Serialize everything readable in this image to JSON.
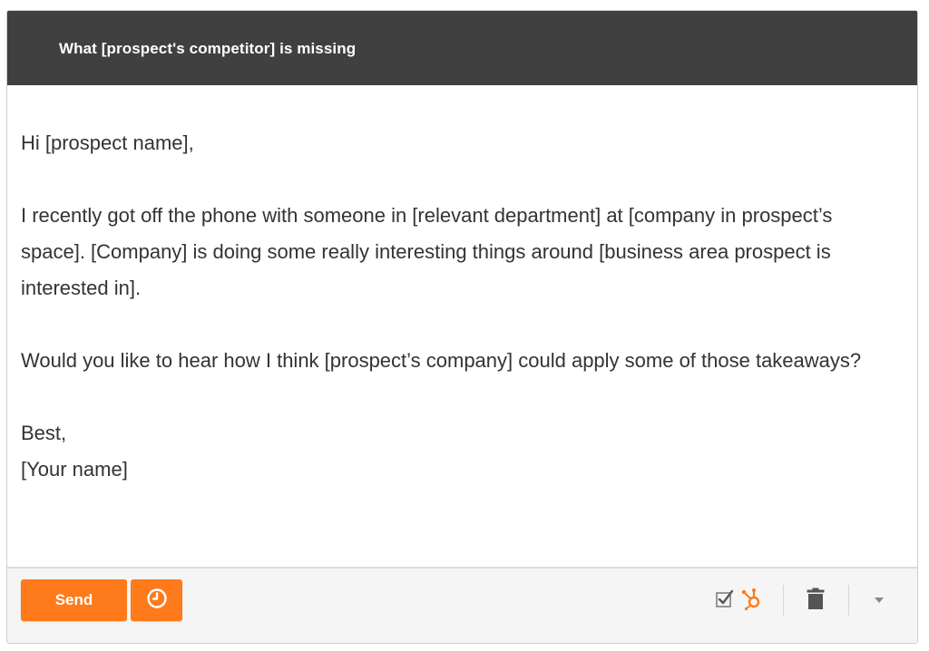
{
  "email": {
    "subject": "What [prospect's competitor] is missing",
    "greeting": "Hi [prospect name],",
    "paragraph1": "I recently got off the phone with someone in [relevant department] at [company in prospect’s space]. [Company] is doing some really interesting things around [business area prospect is interested in].",
    "paragraph2": "Would you like to hear how I think [prospect’s company] could apply some of those takeaways?",
    "signoff": "Best,",
    "signature": "[Your name]"
  },
  "toolbar": {
    "send_label": "Send",
    "icons": {
      "schedule": "clock-icon",
      "track": "checkbox-icon",
      "hubspot": "hubspot-sprocket-icon",
      "delete": "trash-icon",
      "more": "caret-down-icon"
    }
  },
  "colors": {
    "header_bg": "#404040",
    "accent": "#ff7a1a",
    "text": "#333333",
    "footer_bg": "#f5f5f5"
  }
}
